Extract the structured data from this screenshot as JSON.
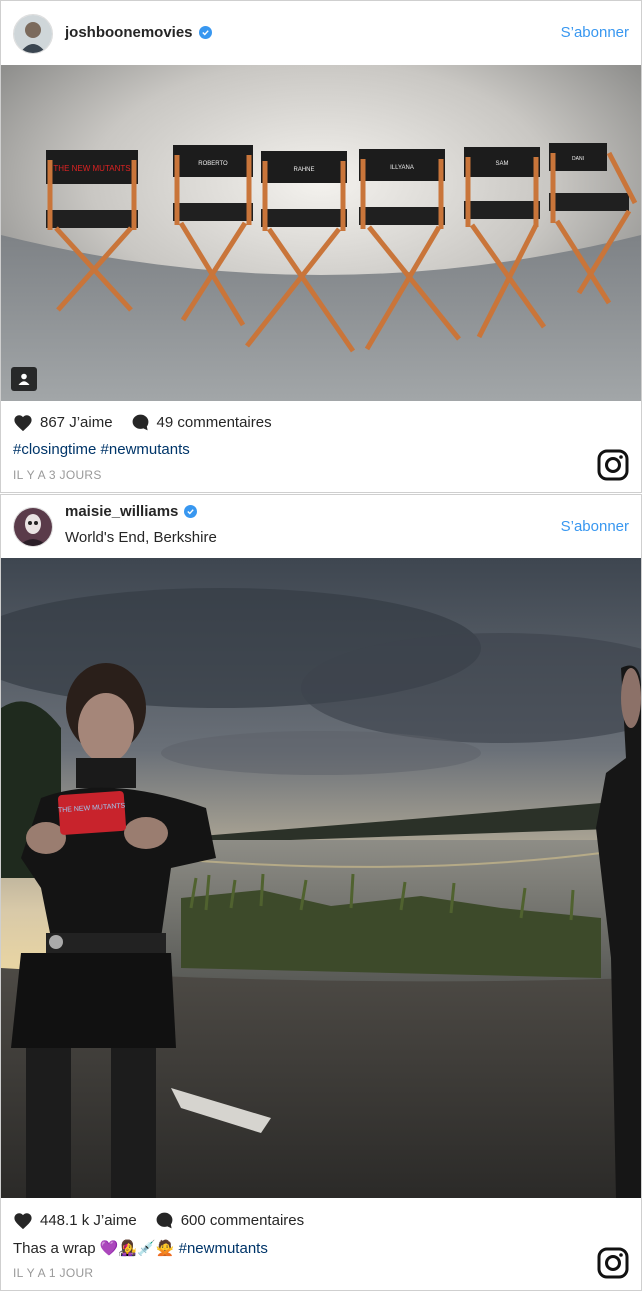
{
  "posts": [
    {
      "username": "joshboonemovies",
      "location": "",
      "follow_label": "S’abonner",
      "likes": "867 J’aime",
      "comments": "49 commentaires",
      "caption_text": "",
      "caption_tags": "#closingtime #newmutants",
      "time": "IL Y A 3 JOURS",
      "chair_labels": [
        "THE NEW MUTANTS",
        "ROBERTO",
        "RAHNE",
        "ILLYANA",
        "SAM",
        "DANI"
      ]
    },
    {
      "username": "maisie_williams",
      "location": "World's End, Berkshire",
      "follow_label": "S’abonner",
      "likes": "448.1 k J’aime",
      "comments": "600 commentaires",
      "caption_text": "Thas a wrap",
      "caption_emojis": "💜👩‍🎤💉🙅",
      "caption_tags": "#newmutants",
      "time": "IL Y A 1 JOUR",
      "card_text": "THE NEW MUTANTS"
    }
  ],
  "colors": {
    "link": "#3897f0",
    "hashtag": "#003569",
    "verified": "#3897f0",
    "meta": "#999999"
  },
  "icons": [
    "verified-badge-icon",
    "heart-icon",
    "comment-icon",
    "instagram-logo-icon",
    "user-tag-icon"
  ]
}
